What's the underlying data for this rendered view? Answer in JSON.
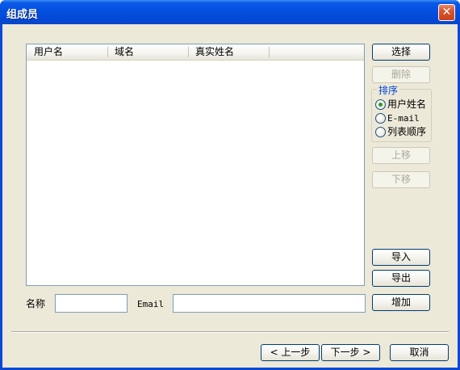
{
  "window": {
    "title": "组成员",
    "close_glyph": "✕"
  },
  "list": {
    "columns": [
      "用户名",
      "域名",
      "真实姓名"
    ],
    "rows": []
  },
  "side_buttons": {
    "select": "选择",
    "delete": "删除",
    "move_up": "上移",
    "move_down": "下移",
    "import": "导入",
    "export": "导出",
    "add": "增加"
  },
  "sort": {
    "label": "排序",
    "options": [
      "用户姓名",
      "E-mail",
      "列表顺序"
    ],
    "selected": "用户姓名"
  },
  "form": {
    "name_label": "名称",
    "name_value": "",
    "email_label": "Email",
    "email_value": ""
  },
  "footer": {
    "prev": "< 上一步",
    "next": "下一步 >",
    "cancel": "取消"
  },
  "colors": {
    "titlebar": "#0551e2",
    "client_bg": "#ece9d8",
    "radio_dot": "#21a121",
    "group_label": "#0046d5"
  }
}
